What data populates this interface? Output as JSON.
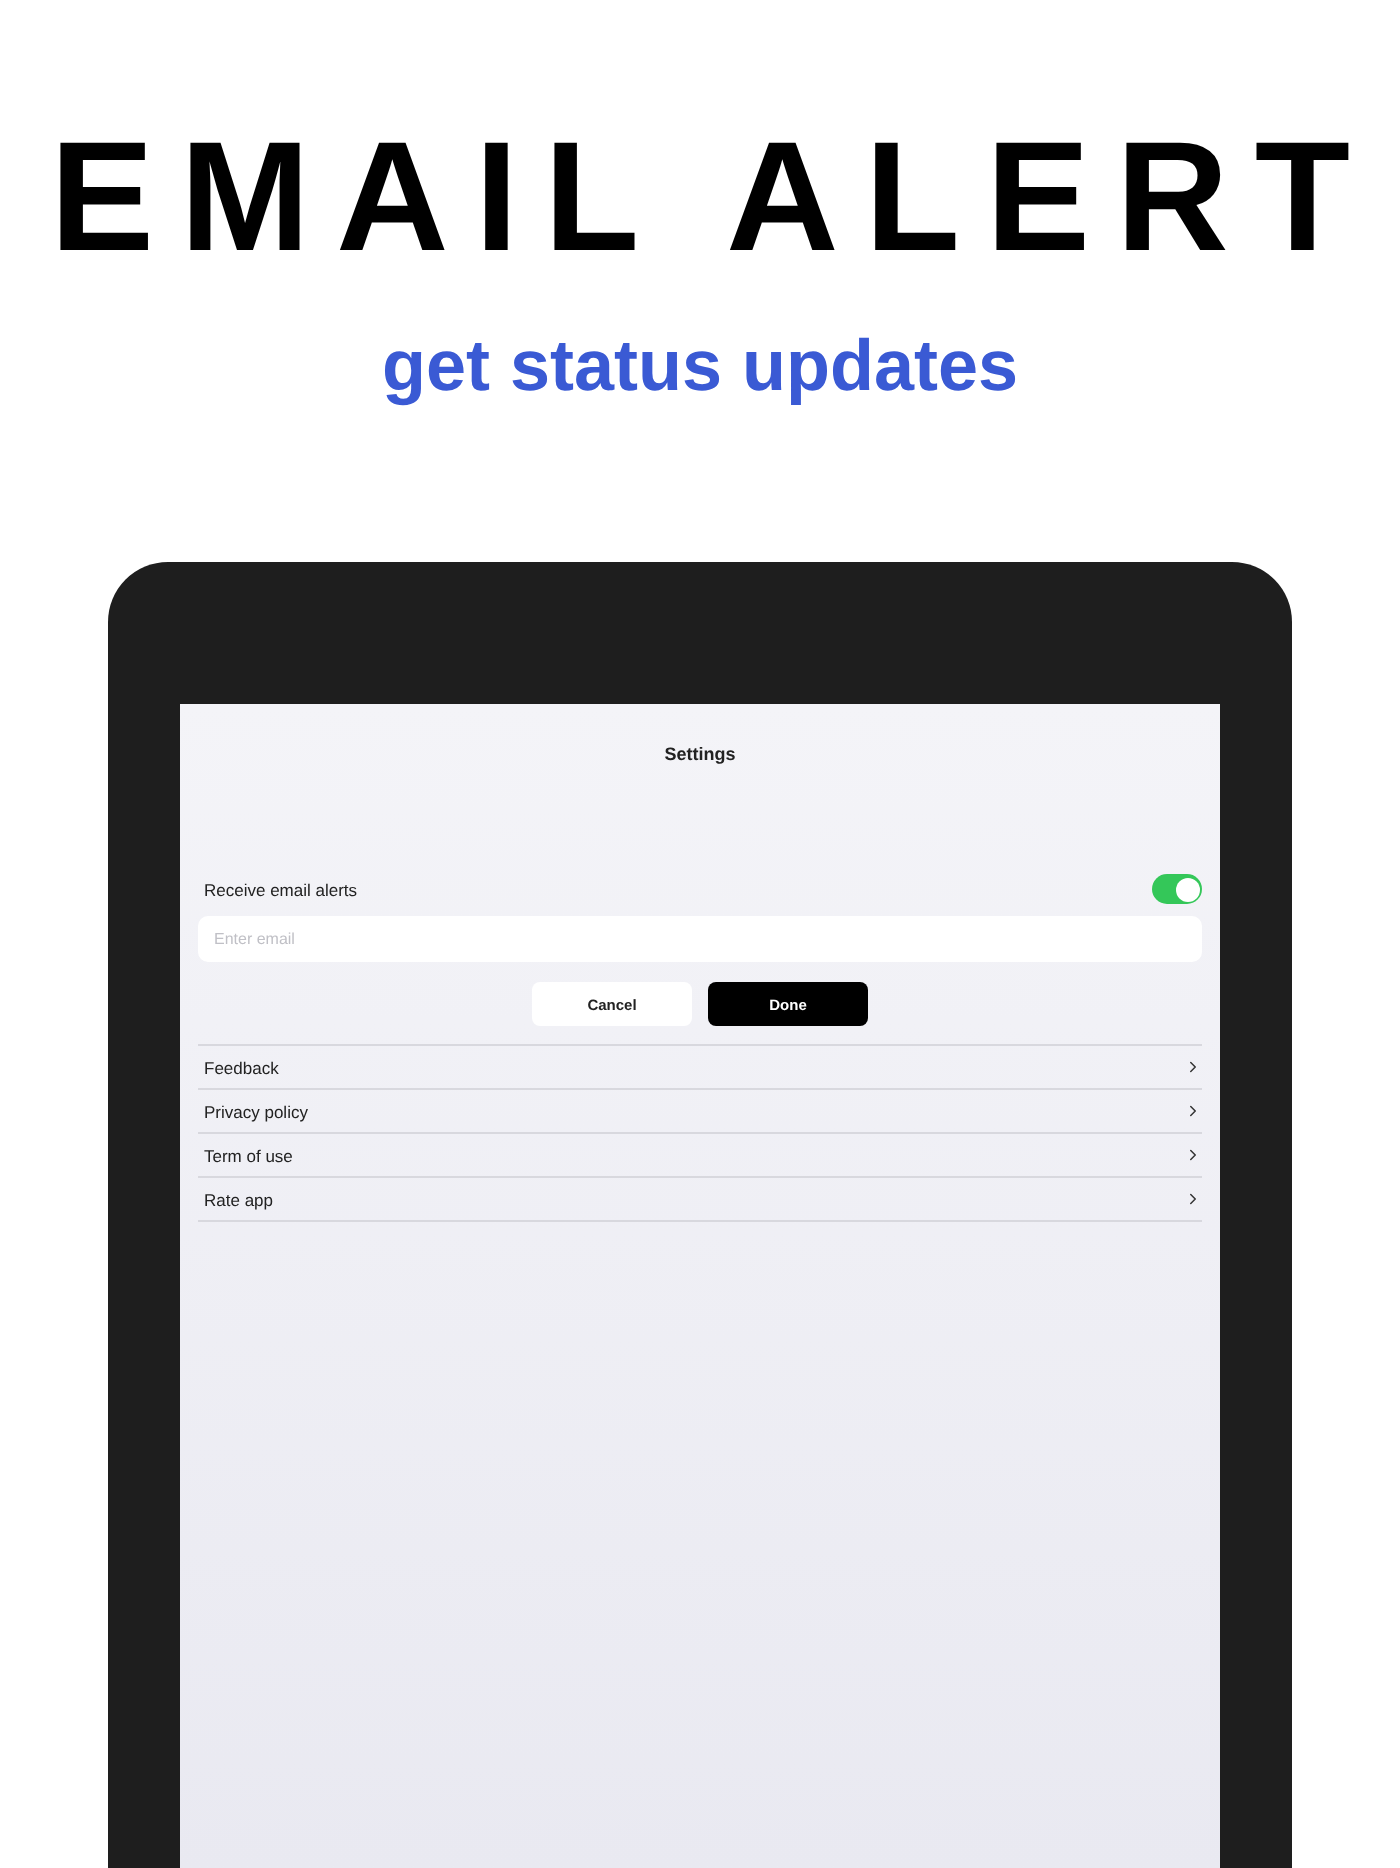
{
  "headline": "EMAIL ALERT",
  "subtitle": "get status updates",
  "screen": {
    "title": "Settings",
    "email_alerts": {
      "label": "Receive email alerts",
      "on": true
    },
    "email_field": {
      "placeholder": "Enter email"
    },
    "buttons": [
      {
        "label": "Cancel",
        "kind": "secondary"
      },
      {
        "label": "Done",
        "kind": "primary"
      }
    ],
    "menu": [
      {
        "label": "Feedback"
      },
      {
        "label": "Privacy policy"
      },
      {
        "label": "Term of use"
      },
      {
        "label": "Rate app"
      }
    ]
  }
}
